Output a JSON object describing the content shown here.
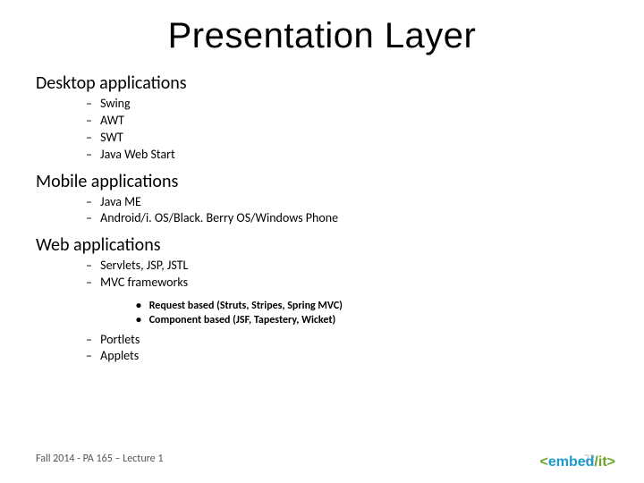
{
  "title": "Presentation Layer",
  "sections": [
    {
      "heading": "Desktop applications",
      "items": [
        "Swing",
        "AWT",
        "SWT",
        "Java Web Start"
      ]
    },
    {
      "heading": "Mobile applications",
      "items": [
        "Java ME",
        "Android/i. OS/Black. Berry OS/Windows Phone"
      ]
    },
    {
      "heading": "Web applications",
      "items_pre": [
        "Servlets, JSP, JSTL",
        "MVC frameworks"
      ],
      "sub": [
        "Request based (Struts, Stripes, Spring MVC)",
        "Component based (JSF, Tapestery, Wicket)"
      ],
      "items_post": [
        "Portlets",
        "Applets"
      ]
    }
  ],
  "footer": "Fall 2014 - PA 165 – Lecture 1",
  "page_number": "22",
  "logo": {
    "lt": "<",
    "embed": "embed",
    "slash": "/",
    "it": "it",
    "gt": ">"
  }
}
